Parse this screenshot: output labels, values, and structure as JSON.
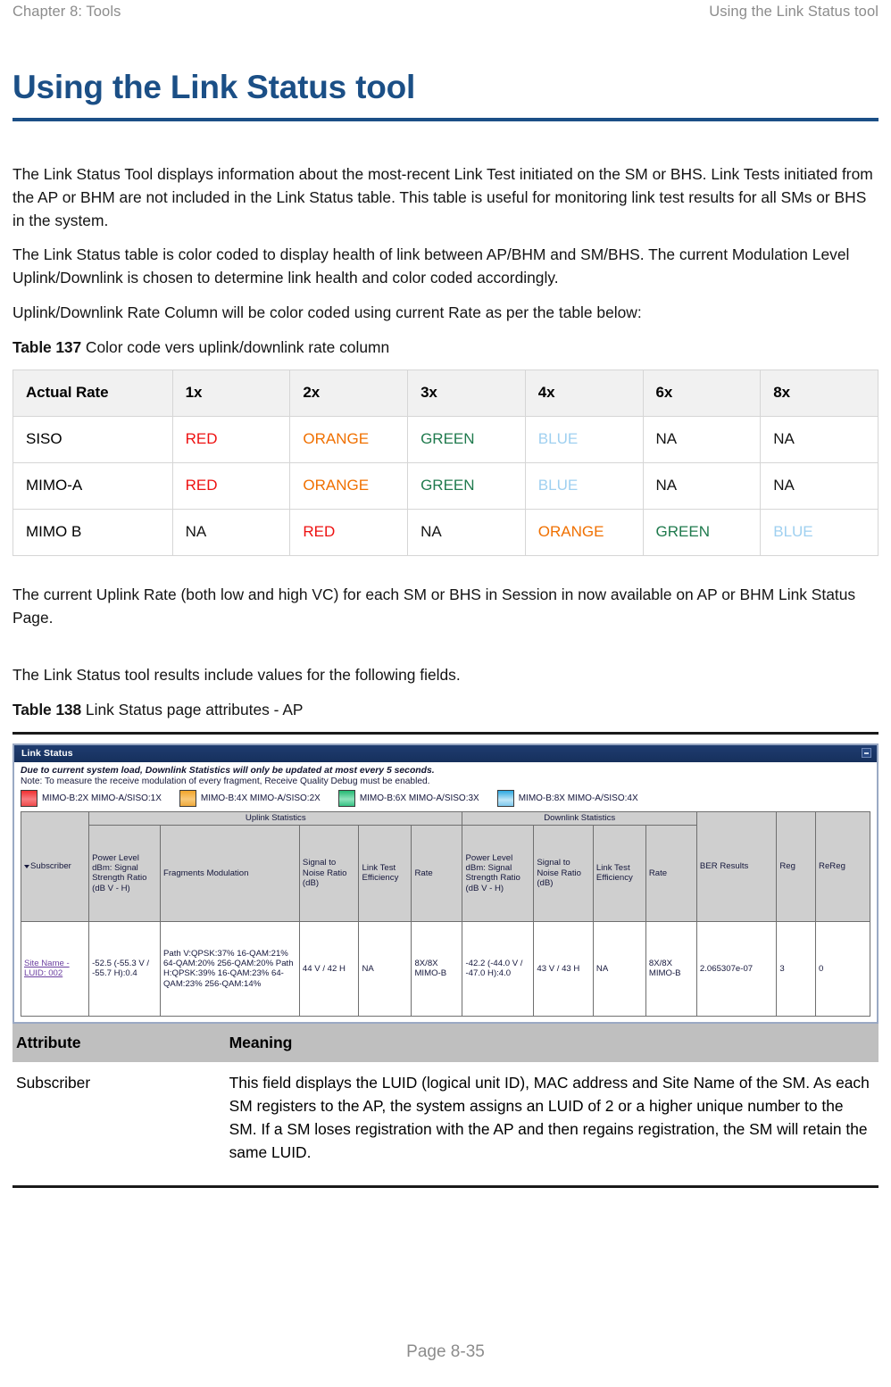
{
  "running_head": {
    "left": "Chapter 8:  Tools",
    "right": "Using the Link Status tool"
  },
  "page_title": "Using the Link Status tool",
  "paragraphs": {
    "p1": "The Link Status Tool displays information about the most-recent Link Test initiated on the SM or BHS. Link Tests initiated from the AP or BHM are not included in the Link Status table.  This table is useful for monitoring link test results for all SMs or BHS in the system.",
    "p2": "The Link Status table is color coded to display health of link between AP/BHM and SM/BHS. The current Modulation Level Uplink/Downlink is chosen to determine link health and color coded accordingly.",
    "p3": "Uplink/Downlink Rate Column will be color coded using current Rate as per the table below:",
    "p4": "The current Uplink Rate (both low and high VC) for each SM or BHS in Session in now available on AP or BHM Link Status Page.",
    "p5": "The Link Status tool results include values for the following fields."
  },
  "table137": {
    "caption_number": "Table 137",
    "caption_text": "Color code vers uplink/downlink rate column",
    "headers": [
      "Actual Rate",
      "1x",
      "2x",
      "3x",
      "4x",
      "6x",
      "8x"
    ],
    "rows": [
      {
        "label": "SISO",
        "cells": [
          {
            "text": "RED",
            "style": "red"
          },
          {
            "text": "ORANGE",
            "style": "orange"
          },
          {
            "text": "GREEN",
            "style": "green"
          },
          {
            "text": "BLUE",
            "style": "blue"
          },
          {
            "text": "NA",
            "style": "na"
          },
          {
            "text": "NA",
            "style": "na"
          }
        ]
      },
      {
        "label": "MIMO-A",
        "cells": [
          {
            "text": "RED",
            "style": "red"
          },
          {
            "text": "ORANGE",
            "style": "orange"
          },
          {
            "text": "GREEN",
            "style": "green"
          },
          {
            "text": "BLUE",
            "style": "blue"
          },
          {
            "text": "NA",
            "style": "na"
          },
          {
            "text": "NA",
            "style": "na"
          }
        ]
      },
      {
        "label": "MIMO B",
        "cells": [
          {
            "text": "NA",
            "style": "na"
          },
          {
            "text": "RED",
            "style": "red"
          },
          {
            "text": "NA",
            "style": "na"
          },
          {
            "text": "ORANGE",
            "style": "orange"
          },
          {
            "text": "GREEN",
            "style": "green"
          },
          {
            "text": "BLUE",
            "style": "blue"
          }
        ]
      }
    ],
    "colors": {
      "red": "#ee1111",
      "orange": "#f07000",
      "green": "#1f7a4d",
      "blue": "#9fd0f0",
      "na": "#141414"
    }
  },
  "table138": {
    "caption_number": "Table 138",
    "caption_text": "Link Status page attributes - AP",
    "headers": [
      "Attribute",
      "Meaning"
    ],
    "rows": [
      {
        "attribute": "Subscriber",
        "meaning": "This field displays the LUID (logical unit ID), MAC address and Site Name of the SM. As each SM registers to the AP, the system assigns an LUID of 2 or a higher unique number to the SM. If a SM loses registration with the AP and then regains registration, the SM will retain the same LUID."
      }
    ]
  },
  "link_status_screenshot": {
    "window_title": "Link Status",
    "warning": "Due to current system load, Downlink Statistics will only be updated at most every 5 seconds.",
    "note": "Note: To measure the receive modulation of every fragment, Receive Quality Debug must be enabled.",
    "legend": [
      {
        "swatch": "red",
        "label": "MIMO-B:2X MIMO-A/SISO:1X"
      },
      {
        "swatch": "orange",
        "label": "MIMO-B:4X MIMO-A/SISO:2X"
      },
      {
        "swatch": "green",
        "label": "MIMO-B:6X MIMO-A/SISO:3X"
      },
      {
        "swatch": "blue",
        "label": "MIMO-B:8X MIMO-A/SISO:4X"
      }
    ],
    "group_headers": {
      "uplink": "Uplink Statistics",
      "downlink": "Downlink Statistics"
    },
    "column_headers": {
      "subscriber": "Subscriber",
      "ul_power": "Power Level dBm: Signal Strength Ratio (dB V - H)",
      "ul_fragments": "Fragments Modulation",
      "ul_snr": "Signal to Noise Ratio (dB)",
      "ul_lte": "Link Test Efficiency",
      "ul_rate": "Rate",
      "dl_power": "Power Level dBm: Signal Strength Ratio (dB V - H)",
      "dl_snr": "Signal to Noise Ratio (dB)",
      "dl_lte": "Link Test Efficiency",
      "dl_rate": "Rate",
      "ber": "BER Results",
      "reg": "Reg",
      "rereg": "ReReg"
    },
    "row": {
      "subscriber": "Site Name - LUID: 002",
      "ul_power": "-52.5 (-55.3 V / -55.7 H):0.4",
      "ul_fragments": "Path V:QPSK:37% 16-QAM:21% 64-QAM:20% 256-QAM:20% Path H:QPSK:39% 16-QAM:23% 64-QAM:23% 256-QAM:14%",
      "ul_snr": "44 V / 42 H",
      "ul_lte": "NA",
      "ul_rate": "8X/8X MIMO-B",
      "dl_power": "-42.2 (-44.0 V / -47.0 H):4.0",
      "dl_snr": "43 V / 43 H",
      "dl_lte": "NA",
      "dl_rate": "8X/8X MIMO-B",
      "ber": "2.065307e-07",
      "reg": "3",
      "rereg": "0"
    }
  },
  "footer": {
    "page_label": "Page 8-35"
  }
}
